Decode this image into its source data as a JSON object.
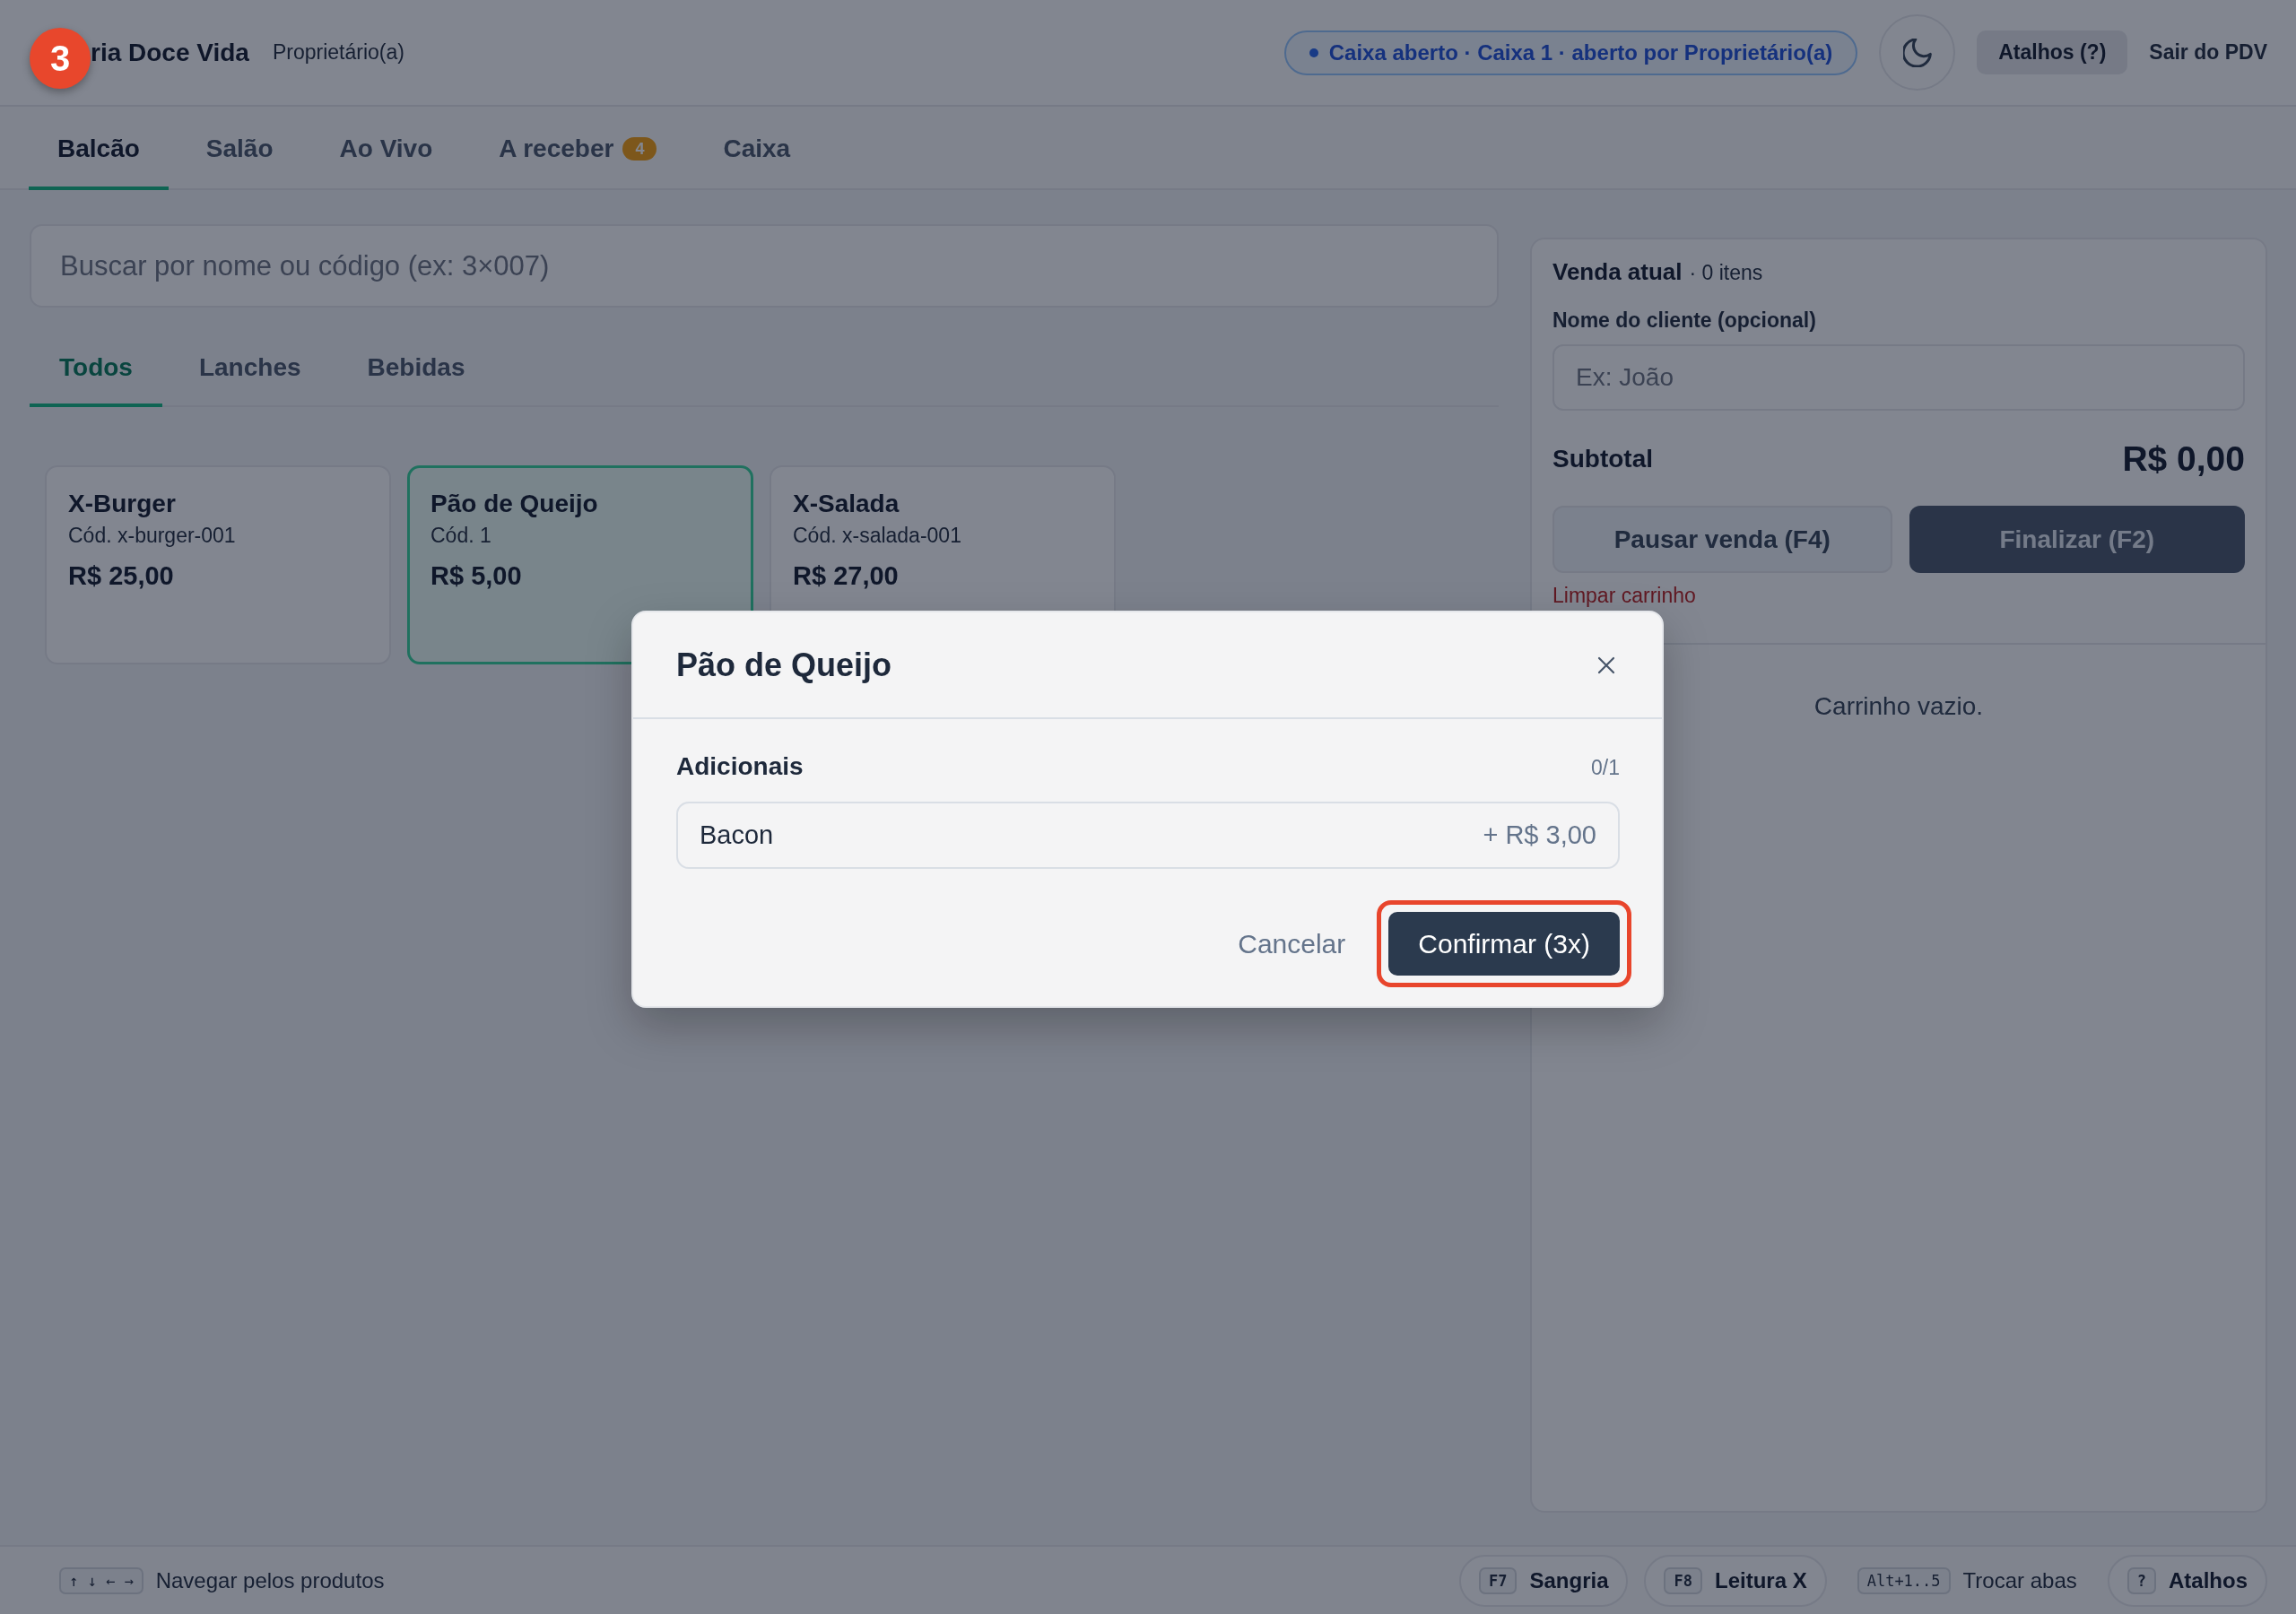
{
  "tutorial": {
    "step": "3"
  },
  "header": {
    "brand": "ria Doce Vida",
    "role": "Proprietário(a)",
    "status": "Caixa aberto · Caixa 1 · aberto por Proprietário(a)",
    "shortcuts_button": "Atalhos (?)",
    "exit_link": "Sair do PDV"
  },
  "tabs": [
    {
      "label": "Balcão",
      "selected": true
    },
    {
      "label": "Salão",
      "selected": false
    },
    {
      "label": "Ao Vivo",
      "selected": false
    },
    {
      "label": "A receber",
      "selected": false,
      "badge": "4"
    },
    {
      "label": "Caixa",
      "selected": false
    }
  ],
  "search": {
    "placeholder": "Buscar por nome ou código (ex: 3×007)"
  },
  "categories": [
    {
      "label": "Todos",
      "selected": true
    },
    {
      "label": "Lanches",
      "selected": false
    },
    {
      "label": "Bebidas",
      "selected": false
    }
  ],
  "products": [
    {
      "name": "X-Burger",
      "code": "Cód. x-burger-001",
      "price": "R$ 25,00",
      "selected": false
    },
    {
      "name": "Pão de Queijo",
      "code": "Cód. 1",
      "price": "R$ 5,00",
      "selected": true
    },
    {
      "name": "X-Salada",
      "code": "Cód. x-salada-001",
      "price": "R$ 27,00",
      "selected": false
    }
  ],
  "sale": {
    "title": "Venda atual",
    "count": "· 0 itens",
    "customer": {
      "label": "Nome do cliente (opcional)",
      "placeholder": "Ex: João"
    },
    "subtotal_label": "Subtotal",
    "subtotal": "R$ 0,00",
    "buttons": [
      {
        "label": "Pausar venda (F4)",
        "kind": "secondary",
        "disabled": true
      },
      {
        "label": "Finalizar (F2)",
        "kind": "primary",
        "disabled": true
      }
    ],
    "clear_link": "Limpar carrinho",
    "empty_message": "Carrinho vazio."
  },
  "footer": {
    "left": [
      {
        "kind": "hint",
        "key": "↑ ↓ ← →",
        "label": "Navegar pelos produtos"
      }
    ],
    "right": [
      {
        "kind": "button",
        "key": "F7",
        "label": "Sangria"
      },
      {
        "kind": "button",
        "key": "F8",
        "label": "Leitura X"
      },
      {
        "kind": "hint",
        "key": "Alt+1..5",
        "label": "Trocar abas"
      },
      {
        "kind": "button",
        "key": "?",
        "label": "Atalhos"
      }
    ]
  },
  "modal": {
    "title": "Pão de Queijo",
    "section": "Adicionais",
    "counter": "0/1",
    "options": [
      {
        "label": "Bacon",
        "price": "+ R$ 3,00",
        "selected": false
      }
    ],
    "cancel": "Cancelar",
    "confirm": {
      "label": "Confirmar (3x)",
      "highlighted": true
    }
  }
}
